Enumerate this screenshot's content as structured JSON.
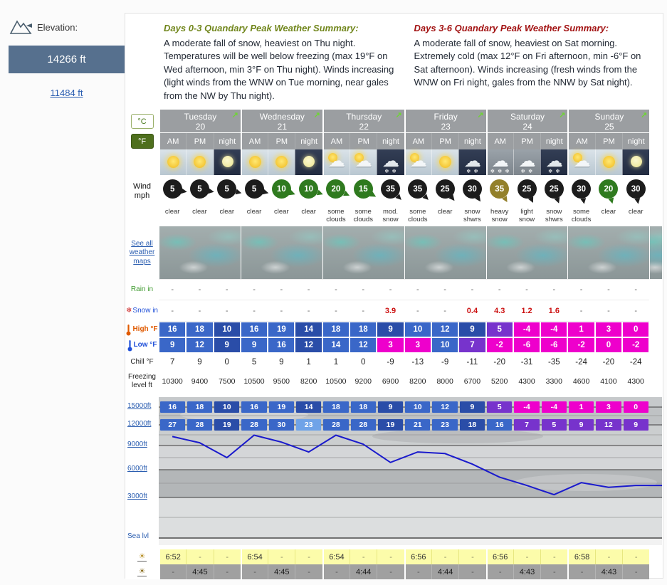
{
  "sidebar": {
    "elevation_label": "Elevation:",
    "primary_elevation": "14266 ft",
    "secondary_elevation": "11484 ft"
  },
  "summaries": [
    {
      "title": "Days 0-3 Quandary Peak Weather Summary:",
      "title_color": "#71861c",
      "text": "A moderate fall of snow, heaviest on Thu night. Temperatures will be well below freezing (max 19°F on Wed afternoon, min 3°F on Thu night). Winds increasing (light winds from the WNW on Tue morning, near gales from the NW by Thu night)."
    },
    {
      "title": "Days 3-6 Quandary Peak Weather Summary:",
      "title_color": "#a31414",
      "text": "A moderate fall of snow, heaviest on Sat morning. Extremely cold (max 12°F on Fri afternoon, min -6°F on Sat afternoon). Winds increasing (fresh winds from the WNW on Fri night, gales from the NNW by Sat night)."
    }
  ],
  "controls": {
    "celsius": "°C",
    "fahrenheit": "°F"
  },
  "labels": {
    "wind": "Wind mph",
    "maps_link": "See all weather maps",
    "rain": "Rain in",
    "snow": "Snow in",
    "high": "High °F",
    "low": "Low °F",
    "chill": "Chill °F",
    "freezing": "Freezing level ft",
    "sea_level": "Sea lvl",
    "elevations": [
      "15000ft",
      "12000ft",
      "9000ft",
      "6000ft",
      "3000ft"
    ]
  },
  "icon_glyphs": {
    "cloud": "☁",
    "snowflake": "❄",
    "expand": "↗",
    "sun": "☀"
  },
  "days": [
    {
      "name": "Tuesday",
      "date": "20"
    },
    {
      "name": "Wednesday",
      "date": "21"
    },
    {
      "name": "Thursday",
      "date": "22"
    },
    {
      "name": "Friday",
      "date": "23"
    },
    {
      "name": "Saturday",
      "date": "24"
    },
    {
      "name": "Sunday",
      "date": "25"
    }
  ],
  "time_labels": [
    "AM",
    "PM",
    "night"
  ],
  "palette": {
    "k": "#1c1c1c",
    "g": "#2f7a1f",
    "y": "#93802a",
    "b": "#3a67c8",
    "n": "#2a4da8",
    "l": "#6fa3e8",
    "p": "#7733cc",
    "m": "#ee00cc"
  },
  "cells": {
    "icons": [
      "sun-day",
      "sun-day",
      "moon-night",
      "sun-day",
      "sun-day",
      "moon-night",
      "cloud-sun-day",
      "cloud-sun-day",
      "snow-night",
      "cloud-sun-day",
      "sun-day",
      "snow-night",
      "heavy-snow-day",
      "snow-day",
      "snow-night",
      "cloud-sun-day",
      "sun-day",
      "moon-night"
    ],
    "wind_speed": [
      5,
      5,
      5,
      5,
      10,
      10,
      20,
      15,
      35,
      35,
      25,
      30,
      35,
      25,
      25,
      30,
      20,
      30
    ],
    "wind_color": [
      "k",
      "k",
      "k",
      "k",
      "g",
      "g",
      "g",
      "g",
      "k",
      "k",
      "k",
      "k",
      "y",
      "k",
      "k",
      "k",
      "g",
      "k"
    ],
    "wind_dir_deg": [
      100,
      100,
      105,
      105,
      110,
      110,
      115,
      120,
      135,
      135,
      140,
      145,
      150,
      155,
      160,
      170,
      165,
      170
    ],
    "condition": [
      "clear",
      "clear",
      "clear",
      "clear",
      "clear",
      "clear",
      "some clouds",
      "some clouds",
      "mod. snow",
      "some clouds",
      "clear",
      "snow shwrs",
      "heavy snow",
      "light snow",
      "snow shwrs",
      "some clouds",
      "clear",
      "clear"
    ],
    "rain_in": [
      "-",
      "-",
      "-",
      "-",
      "-",
      "-",
      "-",
      "-",
      "-",
      "-",
      "-",
      "-",
      "-",
      "-",
      "-",
      "-",
      "-",
      "-"
    ],
    "snow_in": [
      "-",
      "-",
      "-",
      "-",
      "-",
      "-",
      "-",
      "-",
      "3.9",
      "-",
      "-",
      "0.4",
      "4.3",
      "1.2",
      "1.6",
      "-",
      "-",
      "-"
    ],
    "high_f": [
      16,
      18,
      10,
      16,
      19,
      14,
      18,
      18,
      9,
      10,
      12,
      9,
      5,
      -4,
      -4,
      1,
      3,
      0
    ],
    "high_color": [
      "b",
      "b",
      "n",
      "b",
      "b",
      "n",
      "b",
      "b",
      "n",
      "b",
      "b",
      "n",
      "p",
      "m",
      "m",
      "m",
      "m",
      "m"
    ],
    "low_f": [
      9,
      12,
      9,
      9,
      16,
      12,
      14,
      12,
      3,
      3,
      10,
      7,
      -2,
      -6,
      -6,
      -2,
      0,
      -2
    ],
    "low_color": [
      "b",
      "b",
      "n",
      "b",
      "b",
      "n",
      "b",
      "b",
      "m",
      "m",
      "b",
      "p",
      "m",
      "m",
      "m",
      "m",
      "m",
      "m"
    ],
    "chill_f": [
      7,
      9,
      0,
      5,
      9,
      1,
      1,
      0,
      -9,
      -13,
      -9,
      -11,
      -20,
      -31,
      -35,
      -24,
      -20,
      -24
    ],
    "freezing_ft": [
      10300,
      9400,
      7500,
      10500,
      9500,
      8200,
      10500,
      9200,
      6900,
      8200,
      8000,
      6700,
      5200,
      4300,
      3300,
      4600,
      4100,
      4300
    ],
    "temp_15000_f": [
      16,
      18,
      10,
      16,
      19,
      14,
      18,
      18,
      9,
      10,
      12,
      9,
      5,
      -4,
      -4,
      1,
      3,
      0
    ],
    "temp_15000_color": [
      "b",
      "b",
      "n",
      "b",
      "b",
      "n",
      "b",
      "b",
      "n",
      "b",
      "b",
      "n",
      "p",
      "m",
      "m",
      "m",
      "m",
      "m"
    ],
    "temp_12000_f": [
      27,
      28,
      19,
      28,
      30,
      23,
      28,
      28,
      19,
      21,
      23,
      18,
      16,
      7,
      5,
      9,
      12,
      9
    ],
    "temp_12000_color": [
      "b",
      "b",
      "n",
      "b",
      "b",
      "l",
      "b",
      "b",
      "n",
      "b",
      "b",
      "n",
      "b",
      "p",
      "p",
      "p",
      "p",
      "p"
    ]
  },
  "sun": {
    "sunrise": [
      "6:52",
      "6:54",
      "6:54",
      "6:56",
      "6:56",
      "6:58"
    ],
    "sunset": [
      "4:45",
      "4:45",
      "4:44",
      "4:44",
      "4:43",
      "4:43"
    ]
  },
  "chart": {
    "type": "line",
    "series_label": "Freezing level (ft)",
    "line_color": "#1a1acc",
    "y_axis_ft": [
      15000,
      12000,
      9000,
      6000,
      3000,
      0
    ]
  }
}
